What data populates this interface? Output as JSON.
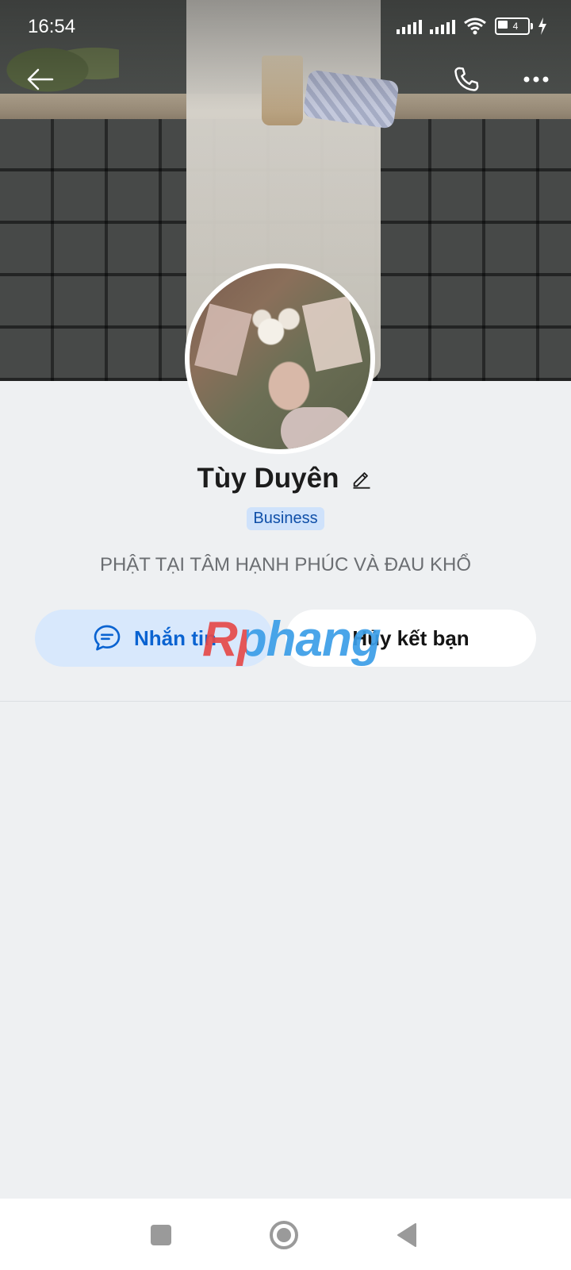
{
  "status_bar": {
    "time": "16:54",
    "battery_level": "4",
    "icons": [
      "signal-icon",
      "signal-icon",
      "wifi-icon",
      "battery-icon",
      "charging-icon"
    ]
  },
  "topbar": {
    "icons": [
      "back-arrow-icon",
      "phone-icon",
      "more-icon"
    ]
  },
  "profile": {
    "name": "Tùy Duyên",
    "badge": "Business",
    "bio": "PHẬT TẠI TÂM HẠNH PHÚC VÀ ĐAU KHỔ"
  },
  "actions": {
    "message_label": "Nhắn tin",
    "unfriend_label": "Hủy kết bạn"
  },
  "watermark": {
    "text": "Rphang"
  },
  "nav_bar": {
    "icons": [
      "recent-apps-icon",
      "home-icon",
      "back-icon"
    ]
  },
  "colors": {
    "accent": "#0a63d1",
    "badge_bg": "#cfe2fb",
    "page_bg": "#eef0f2"
  }
}
